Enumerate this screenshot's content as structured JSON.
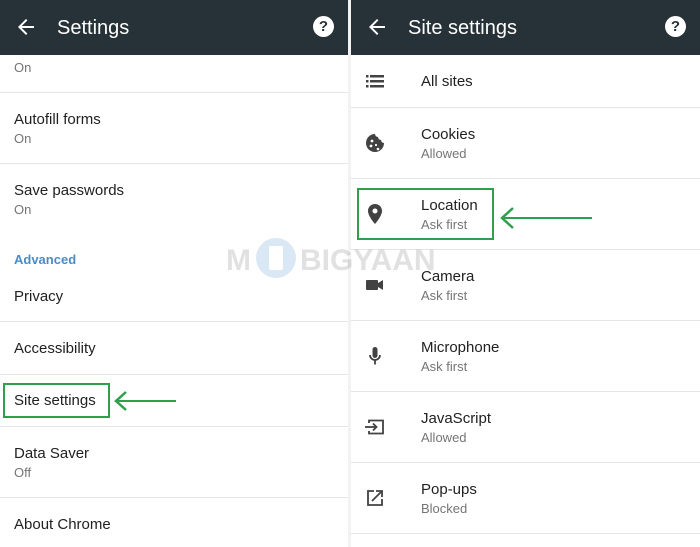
{
  "left": {
    "title": "Settings",
    "help_label": "?",
    "partial_row_secondary": "On",
    "items": [
      {
        "label": "Autofill forms",
        "secondary": "On"
      },
      {
        "label": "Save passwords",
        "secondary": "On"
      },
      {
        "label": "Privacy"
      },
      {
        "label": "Accessibility"
      },
      {
        "label": "Site settings"
      },
      {
        "label": "Data Saver",
        "secondary": "Off"
      },
      {
        "label": "About Chrome"
      }
    ],
    "section_advanced": "Advanced"
  },
  "right": {
    "title": "Site settings",
    "help_label": "?",
    "items": [
      {
        "label": "All sites",
        "icon": "list-icon"
      },
      {
        "label": "Cookies",
        "secondary": "Allowed",
        "icon": "cookie-icon"
      },
      {
        "label": "Location",
        "secondary": "Ask first",
        "icon": "location-pin-icon"
      },
      {
        "label": "Camera",
        "secondary": "Ask first",
        "icon": "camera-icon"
      },
      {
        "label": "Microphone",
        "secondary": "Ask first",
        "icon": "microphone-icon"
      },
      {
        "label": "JavaScript",
        "secondary": "Allowed",
        "icon": "javascript-icon"
      },
      {
        "label": "Pop-ups",
        "secondary": "Blocked",
        "icon": "popup-icon"
      }
    ]
  },
  "colors": {
    "appbar": "#263238",
    "highlight": "#2ea04d",
    "section": "#4a8bc8"
  }
}
